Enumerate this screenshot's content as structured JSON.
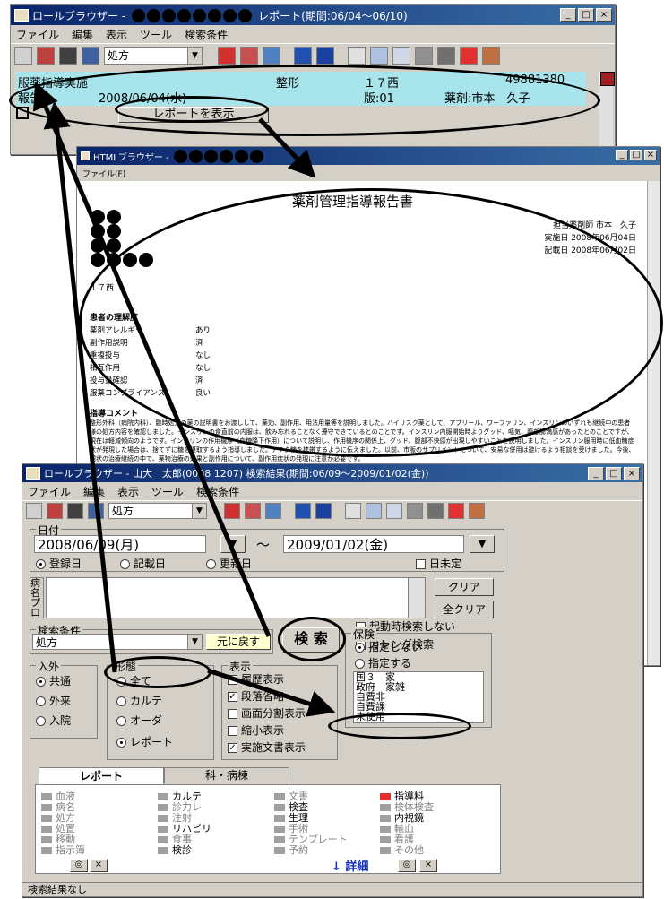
{
  "win1": {
    "title_prefix": "ロールブラウザー -",
    "title_suffix": "レポート(期間:06/04～06/10)",
    "menu": [
      "ファイル",
      "編集",
      "表示",
      "ツール",
      "検索条件"
    ],
    "combo_value": "処方",
    "row1": {
      "item": "服薬指導実施",
      "dept": "整形",
      "ward": "１７西",
      "id": "49881380"
    },
    "row2": {
      "kind": "報告",
      "date": "2008/06/04(水)",
      "version": "版:01",
      "pharmacist": "薬剤:市本　久子"
    },
    "report_button": "レポートを表示"
  },
  "win2": {
    "title": "HTMLブラウザー -",
    "menu": "ファイル(F)",
    "doc": {
      "heading": "薬剤管理指導報告書",
      "pharmacist": "担当薬剤師 市本　久子",
      "impl_date": "実施日 2008年06月04日",
      "record_date": "記載日 2008年06月02日",
      "ward": "１７西",
      "section": "患者の理解度",
      "items": [
        {
          "k": "薬剤アレルギー",
          "v": "あり"
        },
        {
          "k": "副作用説明",
          "v": "済"
        },
        {
          "k": "重複投与",
          "v": "なし"
        },
        {
          "k": "相互作用",
          "v": "なし"
        },
        {
          "k": "投与量確認",
          "v": "済"
        },
        {
          "k": "服薬コンプライアンス",
          "v": "良い"
        }
      ],
      "comment_title": "指導コメント",
      "comment": "整形外科（病院内科）、臨時処方の薬の説明書をお渡しして、薬効、副作用、用法用量等を説明しました。ハイリスク薬として、アプリール、ワーファリン、インスリンのいずれも継続中の患者様の処方内容を確認しました。インスリンの食直前の内服は、飲み忘れることなく遵守できているとのことです。インスリン内服開始時よりグッド、嘔気、腹部膨満感があったとのことですが、現在は軽減傾向のようです。インスリンの作用機序（血糖降下作用）について説明し、作用機序の関係上、グッド、腹部不快感が出現しやすいことを説明しました。インスリン服用時に低血糖症状が発現した場合は、捨てずに糖を摂取するよう指導しました。アテク糖を携帯するように伝えました。以前、市販のサプリメントについて、安易な併用は避けるよう相談を受けました。今後、現状の治療継続の中で、薬物治療の効果と副作用について、副作用症状の発現に注意が必要です。"
    }
  },
  "win3": {
    "title": "ロールブラウザー - 山大　太郎(0008  1207) 検索結果(期間:06/09～2009/01/02(金))",
    "menu": [
      "ファイル",
      "編集",
      "表示",
      "ツール",
      "検索条件"
    ],
    "combo_value": "処方",
    "date_label": "日付",
    "date_from": "2008/06/09(月)",
    "tilde": "～",
    "date_to": "2009/01/02(金)",
    "date_opts": [
      "登録日",
      "記載日",
      "更新日"
    ],
    "undetermined": "日未定",
    "byomei": "病名プロブレム",
    "clear": "クリア",
    "clear_all": "全クリア",
    "cond_label": "検索条件",
    "cond_value": "処方",
    "restore": "元に戻す",
    "search": "検 索",
    "no_startup_search": "起動時検索しない",
    "calendar_search": "カレンダ検索",
    "inout": {
      "label": "入外",
      "opts": [
        "共通",
        "外来",
        "入院"
      ]
    },
    "form": {
      "label": "形態",
      "opts": [
        "全て",
        "カルテ",
        "オーダ",
        "レポート"
      ]
    },
    "disp": {
      "label": "表示",
      "opts": [
        "履歴表示",
        "段落省略",
        "画面分割表示",
        "縮小表示",
        "実施文書表示"
      ]
    },
    "ins": {
      "label": "保険",
      "opts": [
        "指定しない",
        "指定する"
      ],
      "list": [
        "国３　家",
        "政府　家雑",
        "自費非",
        "自費課",
        "未使用"
      ]
    },
    "tabs": [
      "レポート",
      "科・病棟"
    ],
    "report_types": [
      [
        "血液",
        "カルテ",
        "文書",
        "指導料"
      ],
      [
        "病名",
        "診力レ",
        "検査",
        "検体検査"
      ],
      [
        "処方",
        "注射",
        "生理",
        "内視鏡"
      ],
      [
        "処置",
        "リハビリ",
        "手術",
        "輸血"
      ],
      [
        "移動",
        "食事",
        "テンプレート",
        "看護"
      ],
      [
        "指示簿",
        "検診",
        "予約",
        "その他"
      ]
    ],
    "detail": "↓ 詳細",
    "status": "検索結果なし"
  }
}
